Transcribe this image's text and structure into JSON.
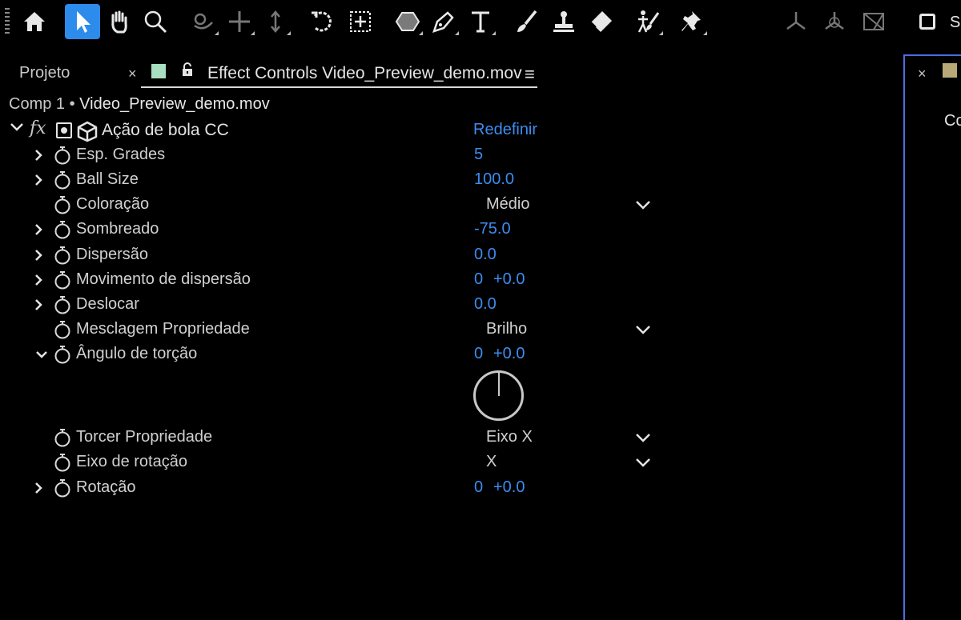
{
  "toolbar": {
    "tools": [
      {
        "name": "home-icon",
        "active": false
      },
      {
        "name": "selection-tool-icon",
        "active": true
      },
      {
        "name": "hand-tool-icon",
        "active": false
      },
      {
        "name": "zoom-tool-icon",
        "active": false
      },
      {
        "name": "orbit-camera-icon",
        "active": false
      },
      {
        "name": "pan-camera-icon",
        "active": false
      },
      {
        "name": "dolly-camera-icon",
        "active": false
      },
      {
        "name": "rotation-tool-icon",
        "active": false
      },
      {
        "name": "pan-behind-icon",
        "active": false
      },
      {
        "name": "shape-tool-icon",
        "active": false
      },
      {
        "name": "pen-tool-icon",
        "active": false
      },
      {
        "name": "type-tool-icon",
        "active": false
      },
      {
        "name": "brush-tool-icon",
        "active": false
      },
      {
        "name": "clone-stamp-icon",
        "active": false
      },
      {
        "name": "eraser-tool-icon",
        "active": false
      },
      {
        "name": "roto-brush-icon",
        "active": false
      },
      {
        "name": "puppet-pin-icon",
        "active": false
      },
      {
        "name": "local-axis-icon",
        "active": false
      },
      {
        "name": "world-axis-icon",
        "active": false
      },
      {
        "name": "view-axis-icon",
        "active": false
      }
    ],
    "snap_label": "Sn",
    "active_color": "#2d8ceb"
  },
  "tabs": {
    "projeto": "Projeto",
    "close": "×",
    "effect_controls": "Effect Controls Video_Preview_demo.mov",
    "menu": "≡",
    "swatch_color": "#a8dfc0"
  },
  "right_panel": {
    "close": "×",
    "text": "Co",
    "swatch_color": "#b8a878"
  },
  "comp_path": {
    "comp": "Comp 1",
    "separator": " • ",
    "layer": "Video_Preview_demo.mov"
  },
  "effect": {
    "fx": "fx",
    "name": "Ação de bola CC",
    "reset": "Redefinir"
  },
  "properties": [
    {
      "name": "Esp. Grades",
      "value": "5",
      "caret": "right"
    },
    {
      "name": "Ball Size",
      "value": "100.0",
      "caret": "right"
    },
    {
      "name": "Coloração",
      "dropdown": "Médio",
      "caret": "none"
    },
    {
      "name": "Sombreado",
      "value": "-75.0",
      "caret": "right"
    },
    {
      "name": "Dispersão",
      "value": "0.0",
      "caret": "right"
    },
    {
      "name": "Movimento de dispersão",
      "value": "0",
      "value2": "+0.0",
      "caret": "right"
    },
    {
      "name": "Deslocar",
      "value": "0.0",
      "caret": "right"
    },
    {
      "name": "Mesclagem Propriedade",
      "dropdown": "Brilho",
      "caret": "none"
    },
    {
      "name": "Ângulo de torção",
      "value": "0",
      "value2": "+0.0",
      "caret": "down"
    },
    {
      "name": "Torcer Propriedade",
      "dropdown": "Eixo X",
      "caret": "none"
    },
    {
      "name": "Eixo de rotação",
      "dropdown": "X",
      "caret": "none"
    },
    {
      "name": "Rotação",
      "value": "0",
      "value2": "+0.0",
      "caret": "right"
    }
  ],
  "colors": {
    "value_blue": "#3d8cf0",
    "panel_border": "#4a6ee0"
  }
}
